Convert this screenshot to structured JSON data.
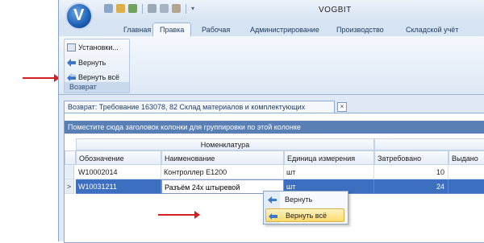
{
  "app": {
    "title": "VOGBIT",
    "logo_letter": "V",
    "quick_access_icons": [
      "save-icon",
      "new-icon",
      "print-icon",
      "tool-icon",
      "copy-icon",
      "paste-icon"
    ]
  },
  "tabs": [
    "Главная",
    "Правка",
    "Рабочая",
    "Администрирование",
    "Производство",
    "Складской учёт"
  ],
  "active_tab": "Правка",
  "ribbon": {
    "group_label": "Возврат",
    "buttons": [
      "Установки...",
      "Вернуть",
      "Вернуть всё"
    ]
  },
  "document_tab": {
    "title": "Возврат: Требование 163078, 82 Склад материалов и комплектующих",
    "close": "×"
  },
  "grid": {
    "group_hint": "Поместите сюда заголовок колонки для группировки по этой колонке",
    "band_header": "Номенклатура",
    "columns": [
      "Обозначение",
      "Наименование",
      "Единица измерения",
      "Затребовано",
      "Выдано"
    ],
    "rows": [
      {
        "indicator": "",
        "code": "W10002014",
        "name": "Контроллер E1200",
        "unit": "шт",
        "requested": "10",
        "issued": ""
      },
      {
        "indicator": ">",
        "code": "W10031211",
        "name": "Разъём 24х штыревой",
        "unit": "шт",
        "requested": "24",
        "issued": ""
      }
    ]
  },
  "context_menu": {
    "items": [
      "Вернуть",
      "Вернуть всё"
    ]
  },
  "colors": {
    "accent": "#3c6fc0",
    "group_bar": "#5a7fb5",
    "annotation_arrow": "#d42020",
    "menu_highlight": "#ffd96b"
  }
}
